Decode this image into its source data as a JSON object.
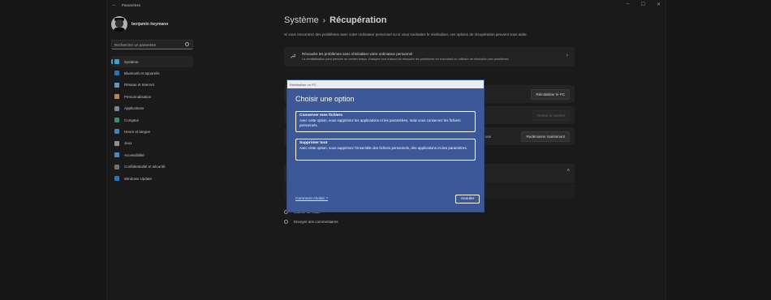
{
  "window": {
    "title": "Paramètres",
    "back_icon": "←",
    "controls": [
      "─",
      "☐",
      "✕"
    ]
  },
  "user": {
    "name": "benjamin heymann"
  },
  "search": {
    "placeholder": "Rechercher un paramètre"
  },
  "nav": {
    "items": [
      {
        "label": "Système",
        "icon": "monitor-icon",
        "color": "#4cc2ff",
        "active": true
      },
      {
        "label": "Bluetooth et appareils",
        "icon": "bluetooth-icon",
        "color": "#2f8ee8"
      },
      {
        "label": "Réseau et Internet",
        "icon": "wifi-icon",
        "color": "#78b8f0"
      },
      {
        "label": "Personnalisation",
        "icon": "pen-icon",
        "color": "#e2a36b"
      },
      {
        "label": "Applications",
        "icon": "apps-icon",
        "color": "#8fa6c0"
      },
      {
        "label": "Comptes",
        "icon": "person-icon",
        "color": "#3fb07a"
      },
      {
        "label": "Heure et langue",
        "icon": "globe-clock-icon",
        "color": "#4aa4f0"
      },
      {
        "label": "Jeux",
        "icon": "gamepad-icon",
        "color": "#b0b0b0"
      },
      {
        "label": "Accessibilité",
        "icon": "accessibility-icon",
        "color": "#5aaaf0"
      },
      {
        "label": "Confidentialité et sécurité",
        "icon": "shield-icon",
        "color": "#8a8a8a"
      },
      {
        "label": "Windows Update",
        "icon": "update-icon",
        "color": "#2f8ee8"
      }
    ]
  },
  "breadcrumb": {
    "parent": "Système",
    "separator": "›",
    "current": "Récupération"
  },
  "page": {
    "description": "Si vous rencontrez des problèmes avec votre ordinateur personnel ou si vous souhaitez le réinitialiser, ces options de récupération peuvent vous aider."
  },
  "troubleshoot": {
    "title": "Résoudre les problèmes sans réinitialiser votre ordinateur personnel",
    "subtitle": "La réinitialisation peut prendre un certain temps. Essayez tout d'abord de résoudre les problèmes en exécutant un utilitaire de résolution des problèmes."
  },
  "recovery": {
    "reset_button": "Réinitialiser le PC",
    "back_button": "Retour en arrière",
    "restart_button": "Redémarrer maintenant",
    "tail_text": "use"
  },
  "links": [
    {
      "label": "Obtenir de l'aide",
      "icon": "help-icon"
    },
    {
      "label": "Envoyer des commentaires",
      "icon": "feedback-icon"
    }
  ],
  "dialog": {
    "title": "Réinitialiser ce PC",
    "heading": "Choisir une option",
    "options": [
      {
        "title": "Conserver mes fichiers",
        "description": "Avec cette option, vous supprimez les applications et les paramètres, mais vous conservez les fichiers personnels."
      },
      {
        "title": "Supprimer tout",
        "description": "Avec cette option, vous supprimez l'ensemble des fichiers personnels, des applications et des paramètres."
      }
    ],
    "help_link": "Comment choisir ?",
    "cancel_button": "Annuler"
  }
}
